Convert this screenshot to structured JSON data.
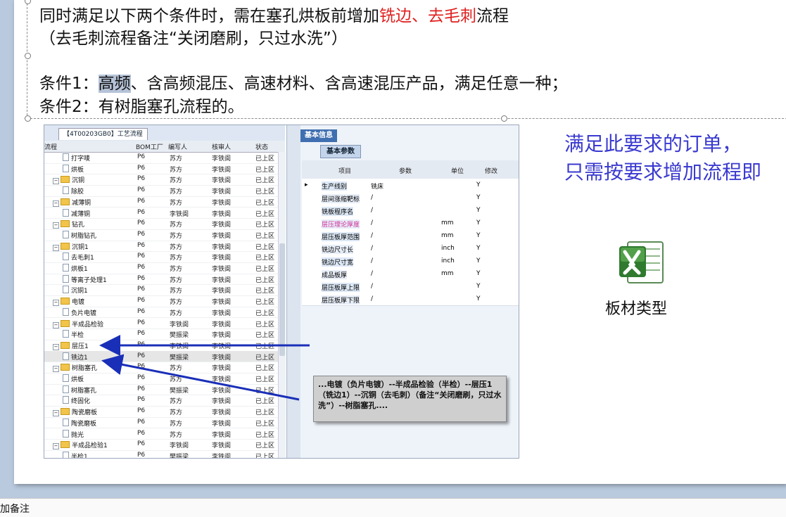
{
  "slide": {
    "line1_a": "同时满足以下两个条件时，需在塞孔烘板前增加",
    "line1_red": "铣边、去毛刺",
    "line1_b": "流程",
    "line2": "（去毛刺流程备注“关闭磨刷，只过水洗”）",
    "cond1_label": "条件1：",
    "cond1_highlight": "高频",
    "cond1_rest": "、含高频混压、高速材料、含高速混压产品，满足任意一种；",
    "cond2": "条件2：有树脂塞孔流程的。",
    "note_line1": "满足此要求的订单，",
    "note_line2": "只需按要求增加流程即",
    "excel_label": "板材类型",
    "excel_icon": "excel-icon",
    "callout": "...电镀（负片电镀）--半成品检验（半检）--层压1（铣边1）--沉铜（去毛刺）（备注“关闭磨刷，只过水洗”）--树脂塞孔....",
    "colors": {
      "red": "#e02020",
      "note_blue": "#3a3ad0",
      "arrow": "#1a2fb8"
    }
  },
  "embedded": {
    "grid_tab": "【4T00203GB0】工艺流程",
    "grid_headers": [
      "流程",
      "BOM工厂",
      "编写人",
      "核审人",
      "状态"
    ],
    "rows": [
      {
        "indent": 2,
        "kind": "doc",
        "name": "打字唛",
        "factory": "P6",
        "writer": "苏方",
        "reviewer": "李铁阆",
        "status": "已上区"
      },
      {
        "indent": 2,
        "kind": "doc",
        "name": "烘板",
        "factory": "P6",
        "writer": "苏方",
        "reviewer": "李铁阆",
        "status": "已上区"
      },
      {
        "indent": 1,
        "kind": "folder",
        "name": "沉铜",
        "factory": "P6",
        "writer": "苏方",
        "reviewer": "李铁阆",
        "status": "已上区"
      },
      {
        "indent": 2,
        "kind": "doc",
        "name": "除胶",
        "factory": "P6",
        "writer": "苏方",
        "reviewer": "李铁阆",
        "status": "已上区"
      },
      {
        "indent": 1,
        "kind": "folder",
        "name": "减薄铜",
        "factory": "P6",
        "writer": "苏方",
        "reviewer": "李铁阆",
        "status": "已上区"
      },
      {
        "indent": 2,
        "kind": "doc",
        "name": "减薄铜",
        "factory": "P6",
        "writer": "李铁阆",
        "reviewer": "李铁阆",
        "status": "已上区"
      },
      {
        "indent": 1,
        "kind": "folder",
        "name": "钻孔",
        "factory": "P6",
        "writer": "苏方",
        "reviewer": "李铁阆",
        "status": "已上区"
      },
      {
        "indent": 2,
        "kind": "doc",
        "name": "树脂钻孔",
        "factory": "P6",
        "writer": "苏方",
        "reviewer": "李铁阆",
        "status": "已上区"
      },
      {
        "indent": 1,
        "kind": "folder",
        "name": "沉铜1",
        "factory": "P6",
        "writer": "苏方",
        "reviewer": "李铁阆",
        "status": "已上区"
      },
      {
        "indent": 2,
        "kind": "doc",
        "name": "去毛刺1",
        "factory": "P6",
        "writer": "苏方",
        "reviewer": "李铁阆",
        "status": "已上区"
      },
      {
        "indent": 2,
        "kind": "doc",
        "name": "烘板1",
        "factory": "P6",
        "writer": "苏方",
        "reviewer": "李铁阆",
        "status": "已上区"
      },
      {
        "indent": 2,
        "kind": "doc",
        "name": "等离子处理1",
        "factory": "P6",
        "writer": "苏方",
        "reviewer": "李铁阆",
        "status": "已上区"
      },
      {
        "indent": 2,
        "kind": "doc",
        "name": "沉铜1",
        "factory": "P6",
        "writer": "苏方",
        "reviewer": "李铁阆",
        "status": "已上区"
      },
      {
        "indent": 1,
        "kind": "folder",
        "name": "电镀",
        "factory": "P6",
        "writer": "苏方",
        "reviewer": "李铁阆",
        "status": "已上区"
      },
      {
        "indent": 2,
        "kind": "doc",
        "name": "负片电镀",
        "factory": "P6",
        "writer": "苏方",
        "reviewer": "李铁阆",
        "status": "已上区"
      },
      {
        "indent": 1,
        "kind": "folder",
        "name": "半成品检验",
        "factory": "P6",
        "writer": "李铁阆",
        "reviewer": "李铁阆",
        "status": "已上区"
      },
      {
        "indent": 2,
        "kind": "doc",
        "name": "半检",
        "factory": "P6",
        "writer": "樊振梁",
        "reviewer": "李铁阆",
        "status": "已上区"
      },
      {
        "indent": 1,
        "kind": "folder",
        "name": "层压1",
        "factory": "P6",
        "writer": "李铁阆",
        "reviewer": "李铁阆",
        "status": "已上区"
      },
      {
        "indent": 2,
        "kind": "doc",
        "name": "铣边1",
        "factory": "P6",
        "writer": "樊振梁",
        "reviewer": "李铁阆",
        "status": "已上区"
      },
      {
        "indent": 1,
        "kind": "folder",
        "name": "树脂塞孔",
        "factory": "P6",
        "writer": "苏方",
        "reviewer": "李铁阆",
        "status": "已上区"
      },
      {
        "indent": 2,
        "kind": "doc",
        "name": "烘板",
        "factory": "P6",
        "writer": "苏方",
        "reviewer": "李铁阆",
        "status": "已上区"
      },
      {
        "indent": 2,
        "kind": "doc",
        "name": "树脂塞孔",
        "factory": "P6",
        "writer": "樊振梁",
        "reviewer": "李铁阆",
        "status": "已上区"
      },
      {
        "indent": 2,
        "kind": "doc",
        "name": "终固化",
        "factory": "P6",
        "writer": "苏方",
        "reviewer": "李铁阆",
        "status": "已上区"
      },
      {
        "indent": 1,
        "kind": "folder",
        "name": "陶瓷磨板",
        "factory": "P6",
        "writer": "苏方",
        "reviewer": "李铁阆",
        "status": "已上区"
      },
      {
        "indent": 2,
        "kind": "doc",
        "name": "陶瓷磨板",
        "factory": "P6",
        "writer": "苏方",
        "reviewer": "李铁阆",
        "status": "已上区"
      },
      {
        "indent": 2,
        "kind": "doc",
        "name": "抛光",
        "factory": "P6",
        "writer": "苏方",
        "reviewer": "李铁阆",
        "status": "已上区"
      },
      {
        "indent": 1,
        "kind": "folder",
        "name": "半成品检验1",
        "factory": "P6",
        "writer": "李铁阆",
        "reviewer": "李铁阆",
        "status": "已上区"
      },
      {
        "indent": 2,
        "kind": "doc",
        "name": "半检1",
        "factory": "P6",
        "writer": "樊振梁",
        "reviewer": "李铁阆",
        "status": "已上区"
      }
    ],
    "right_title": "基本信息",
    "right_tab": "基本参数",
    "param_headers": [
      "项目",
      "参数",
      "单位",
      "修改"
    ],
    "params": [
      {
        "name": "生产线别",
        "value": "铣床",
        "unit": "",
        "edit": "Y",
        "pink": false,
        "selected": true
      },
      {
        "name": "层间涨缩靶标",
        "value": "/",
        "unit": "",
        "edit": "Y",
        "pink": false,
        "selected": false
      },
      {
        "name": "铣板程序名",
        "value": "/",
        "unit": "",
        "edit": "Y",
        "pink": false,
        "selected": false
      },
      {
        "name": "层压理论厚度",
        "value": "/",
        "unit": "mm",
        "edit": "Y",
        "pink": true,
        "selected": false
      },
      {
        "name": "层压板厚范围",
        "value": "/",
        "unit": "mm",
        "edit": "Y",
        "pink": false,
        "selected": false
      },
      {
        "name": "铣边尺寸长",
        "value": "/",
        "unit": "inch",
        "edit": "Y",
        "pink": false,
        "selected": false
      },
      {
        "name": "铣边尺寸宽",
        "value": "/",
        "unit": "inch",
        "edit": "Y",
        "pink": false,
        "selected": false
      },
      {
        "name": "成品板厚",
        "value": "/",
        "unit": "mm",
        "edit": "Y",
        "pink": false,
        "selected": false
      },
      {
        "name": "层压板厚上限",
        "value": "/",
        "unit": "",
        "edit": "Y",
        "pink": false,
        "selected": false
      },
      {
        "name": "层压板厚下限",
        "value": "/",
        "unit": "",
        "edit": "Y",
        "pink": false,
        "selected": false
      }
    ]
  },
  "status": {
    "text": "加备注"
  }
}
